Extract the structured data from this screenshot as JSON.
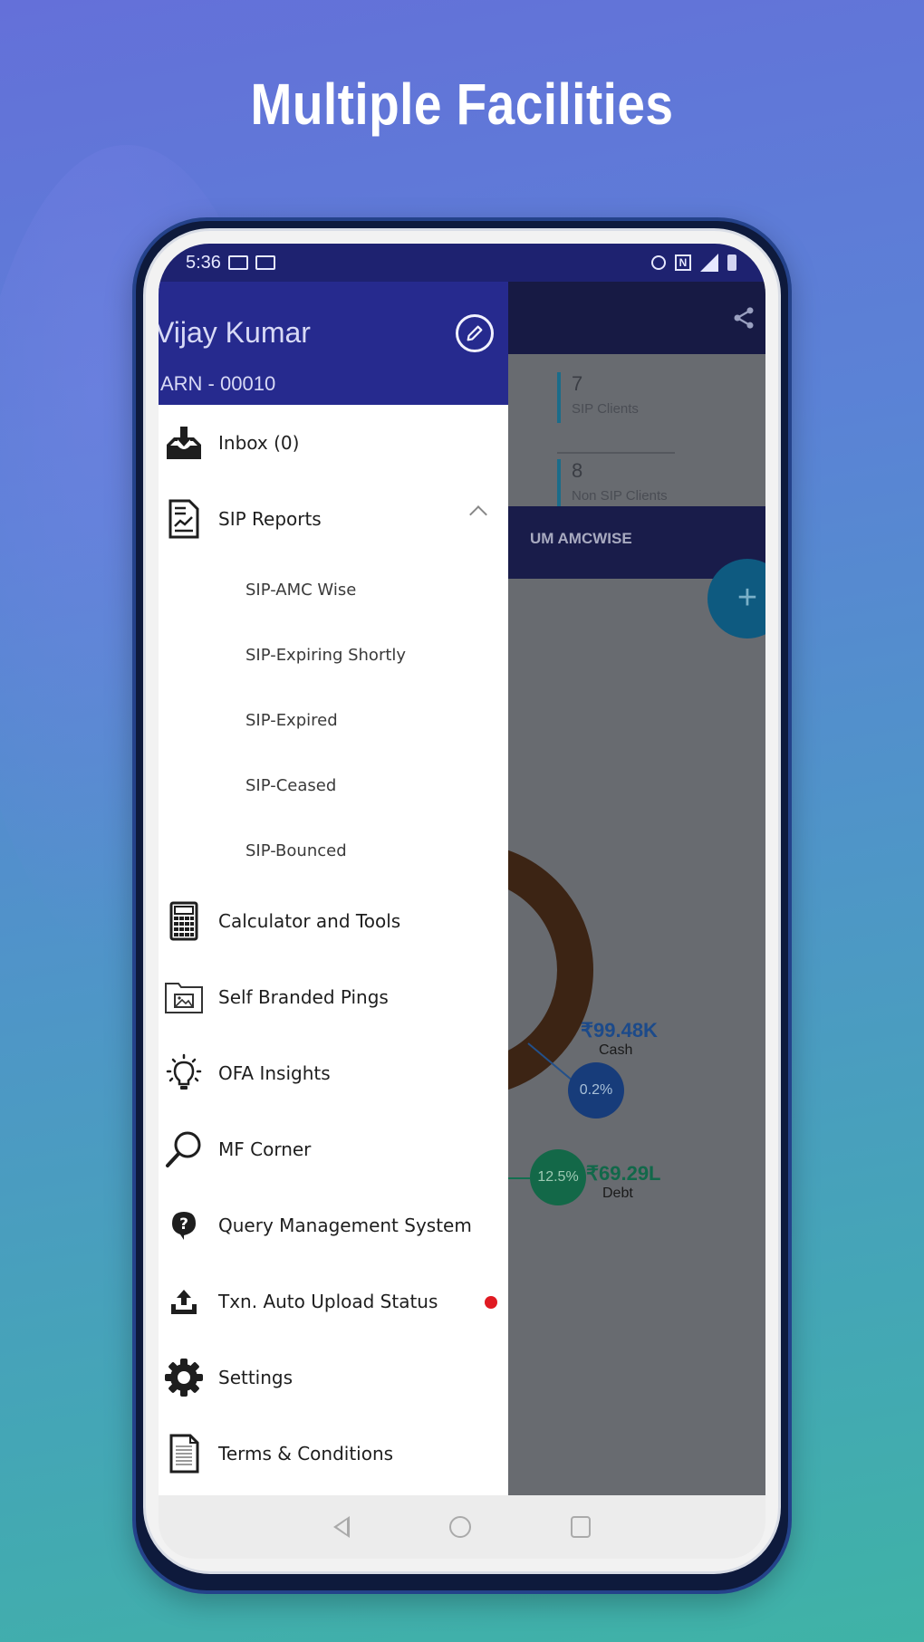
{
  "headline": "Multiple Facilities",
  "status_bar": {
    "time": "5:36",
    "left_icons": [
      "gallery-icon",
      "gmail-icon"
    ],
    "right_icons": [
      "alarm-icon",
      "nfc-icon",
      "signal-4g-icon",
      "battery-icon"
    ]
  },
  "drawer": {
    "user_name": "Vijay Kumar",
    "arn": "ARN - 00010",
    "edit_icon": "edit-pencil-icon",
    "items": [
      {
        "label": "Inbox (0)",
        "icon": "inbox-download-icon"
      },
      {
        "label": "SIP Reports",
        "icon": "report-chart-icon",
        "expanded": true,
        "children": [
          {
            "label": "SIP-AMC Wise"
          },
          {
            "label": "SIP-Expiring Shortly"
          },
          {
            "label": "SIP-Expired"
          },
          {
            "label": "SIP-Ceased"
          },
          {
            "label": "SIP-Bounced"
          }
        ]
      },
      {
        "label": "Calculator and Tools",
        "icon": "calculator-icon"
      },
      {
        "label": "Self Branded Pings",
        "icon": "image-folder-icon"
      },
      {
        "label": "OFA Insights",
        "icon": "lightbulb-icon"
      },
      {
        "label": "MF Corner",
        "icon": "search-icon"
      },
      {
        "label": "Query Management System",
        "icon": "question-bubble-icon"
      },
      {
        "label": "Txn. Auto Upload Status",
        "icon": "upload-icon",
        "badge": "red-dot",
        "badge_color": "#e01a22"
      },
      {
        "label": "Settings",
        "icon": "gear-icon"
      },
      {
        "label": "Terms & Conditions",
        "icon": "document-icon"
      }
    ]
  },
  "background_app": {
    "share_icon": "share-icon",
    "stats": [
      {
        "value": "7",
        "label": "SIP Clients"
      },
      {
        "value": "8",
        "label": "Non SIP Clients"
      }
    ],
    "tab_label": "UM AMCWISE",
    "fab_label": "+",
    "allocations": [
      {
        "name": "Cash",
        "amount": "₹99.48K",
        "percent": "0.2%",
        "color": "#173c7a"
      },
      {
        "name": "Debt",
        "amount": "₹69.29L",
        "percent": "12.5%",
        "color": "#136848"
      }
    ]
  },
  "colors": {
    "header": "#262a8e",
    "status_bar": "#1e2270",
    "accent_badge": "#e01a22"
  }
}
